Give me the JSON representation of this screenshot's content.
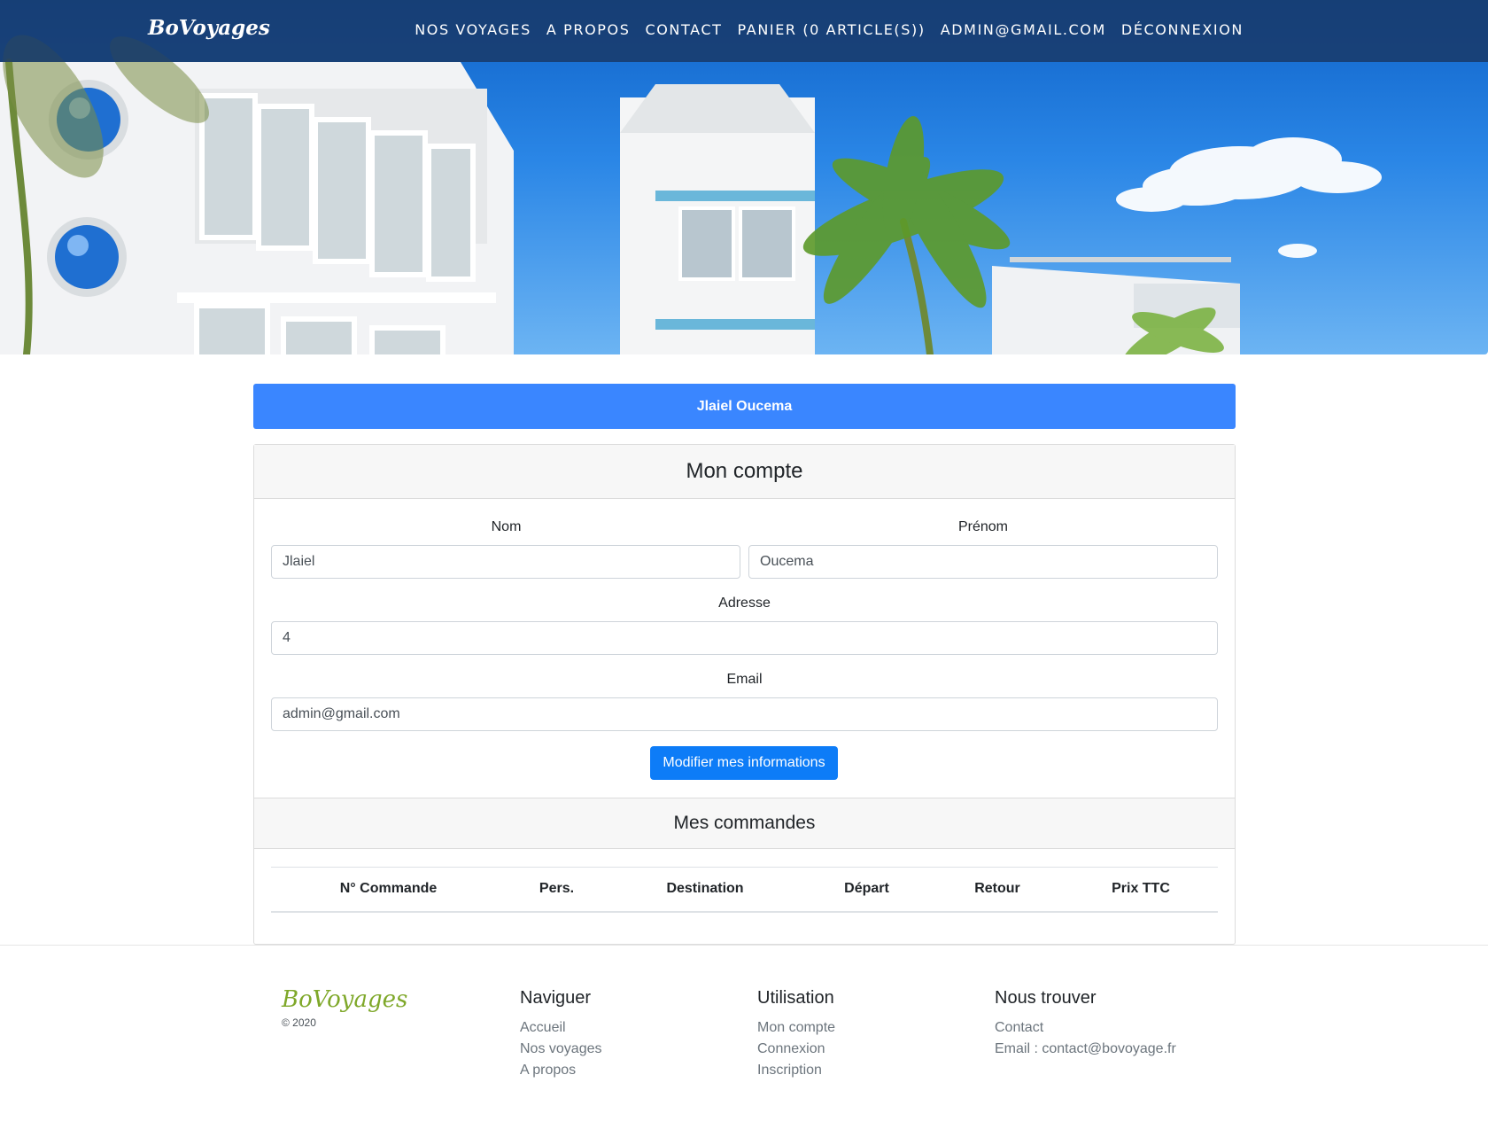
{
  "nav": {
    "brand": "BoVoyages",
    "links": [
      "NOS VOYAGES",
      "A PROPOS",
      "CONTACT",
      "PANIER (0 ARTICLE(S))",
      "ADMIN@GMAIL.COM",
      "DÉCONNEXION"
    ]
  },
  "user_banner": "Jlaiel Oucema",
  "account": {
    "title": "Mon compte",
    "nom_label": "Nom",
    "nom_value": "Jlaiel",
    "prenom_label": "Prénom",
    "prenom_value": "Oucema",
    "adresse_label": "Adresse",
    "adresse_value": "4",
    "email_label": "Email",
    "email_value": "admin@gmail.com",
    "submit_label": "Modifier mes informations"
  },
  "orders": {
    "title": "Mes commandes",
    "columns": [
      "N° Commande",
      "Pers.",
      "Destination",
      "Départ",
      "Retour",
      "Prix TTC"
    ]
  },
  "footer": {
    "brand": "BoVoyages",
    "copyright": "© 2020",
    "naviguer": {
      "title": "Naviguer",
      "links": [
        "Accueil",
        "Nos voyages",
        "A propos"
      ]
    },
    "utilisation": {
      "title": "Utilisation",
      "links": [
        "Mon compte",
        "Connexion",
        "Inscription"
      ]
    },
    "nous_trouver": {
      "title": "Nous trouver",
      "links": [
        "Contact",
        "Email : contact@bovoyage.fr"
      ]
    }
  }
}
